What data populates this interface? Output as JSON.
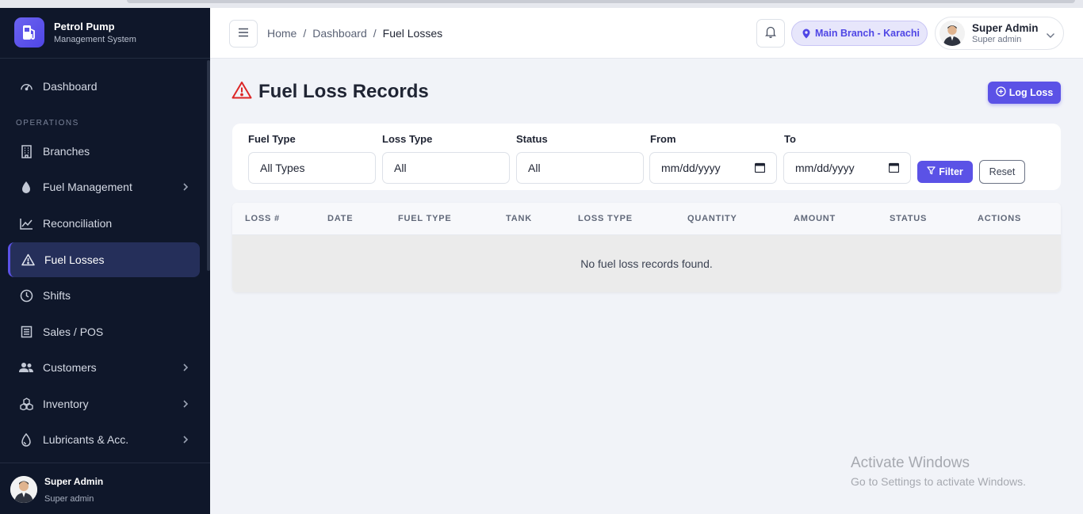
{
  "brand": {
    "title": "Petrol Pump",
    "subtitle": "Management System"
  },
  "sidebar": {
    "section_label": "OPERATIONS",
    "items": [
      {
        "label": "Dashboard",
        "icon": "gauge-icon"
      },
      {
        "label": "Branches",
        "icon": "building-icon"
      },
      {
        "label": "Fuel Management",
        "icon": "droplet-icon",
        "expandable": true
      },
      {
        "label": "Reconciliation",
        "icon": "chart-line-icon"
      },
      {
        "label": "Fuel Losses",
        "icon": "warning-icon",
        "active": true
      },
      {
        "label": "Shifts",
        "icon": "clock-icon"
      },
      {
        "label": "Sales / POS",
        "icon": "receipt-icon"
      },
      {
        "label": "Customers",
        "icon": "users-icon",
        "expandable": true
      },
      {
        "label": "Inventory",
        "icon": "boxes-icon",
        "expandable": true
      },
      {
        "label": "Lubricants & Acc.",
        "icon": "oil-drop-icon",
        "expandable": true
      }
    ],
    "footer": {
      "name": "Super Admin",
      "role": "Super admin"
    }
  },
  "topbar": {
    "breadcrumb": [
      "Home",
      "Dashboard",
      "Fuel Losses"
    ],
    "separator": "/",
    "branch": "Main Branch - Karachi",
    "user": {
      "name": "Super Admin",
      "role": "Super admin"
    }
  },
  "page": {
    "title": "Fuel Loss Records",
    "log_button": "Log Loss"
  },
  "filters": {
    "fuel_type": {
      "label": "Fuel Type",
      "value": "All Types"
    },
    "loss_type": {
      "label": "Loss Type",
      "value": "All"
    },
    "status": {
      "label": "Status",
      "value": "All"
    },
    "from": {
      "label": "From",
      "placeholder": "mm/dd/yyyy"
    },
    "to": {
      "label": "To",
      "placeholder": "mm/dd/yyyy"
    },
    "filter_button": "Filter",
    "reset_button": "Reset"
  },
  "table": {
    "columns": [
      "LOSS #",
      "DATE",
      "FUEL TYPE",
      "TANK",
      "LOSS TYPE",
      "QUANTITY",
      "AMOUNT",
      "STATUS",
      "ACTIONS"
    ],
    "empty_message": "No fuel loss records found."
  },
  "watermark": {
    "line1": "Activate Windows",
    "line2": "Go to Settings to activate Windows."
  },
  "colors": {
    "accent": "#5b52e6",
    "sidebar_bg": "#0f172a",
    "danger": "#dc2626"
  }
}
